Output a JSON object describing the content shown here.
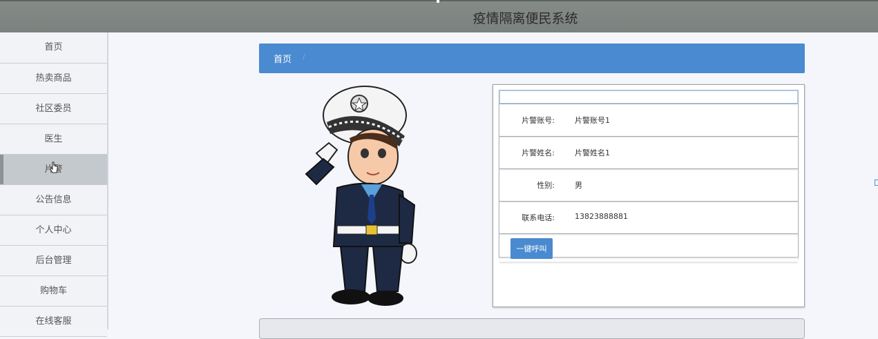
{
  "header": {
    "title": "疫情隔离便民系统"
  },
  "sidebar": {
    "items": [
      {
        "label": "首页",
        "active": false
      },
      {
        "label": "热卖商品",
        "active": false
      },
      {
        "label": "社区委员",
        "active": false
      },
      {
        "label": "医生",
        "active": false
      },
      {
        "label": "片警",
        "active": true
      },
      {
        "label": "公告信息",
        "active": false
      },
      {
        "label": "个人中心",
        "active": false
      },
      {
        "label": "后台管理",
        "active": false
      },
      {
        "label": "购物车",
        "active": false
      },
      {
        "label": "在线客服",
        "active": false
      }
    ]
  },
  "breadcrumb": {
    "home": "首页",
    "separator": "/"
  },
  "detail": {
    "fields": [
      {
        "label": "片警账号:",
        "value": "片警账号1"
      },
      {
        "label": "片警姓名:",
        "value": "片警姓名1"
      },
      {
        "label": "性别:",
        "value": "男"
      },
      {
        "label": "联系电话:",
        "value": "13823888881"
      }
    ],
    "call_button": "一键呼叫"
  },
  "colors": {
    "accent": "#4a8ad0",
    "topbar": "#7f8582",
    "sidebar_active": "#c4c9cd"
  }
}
